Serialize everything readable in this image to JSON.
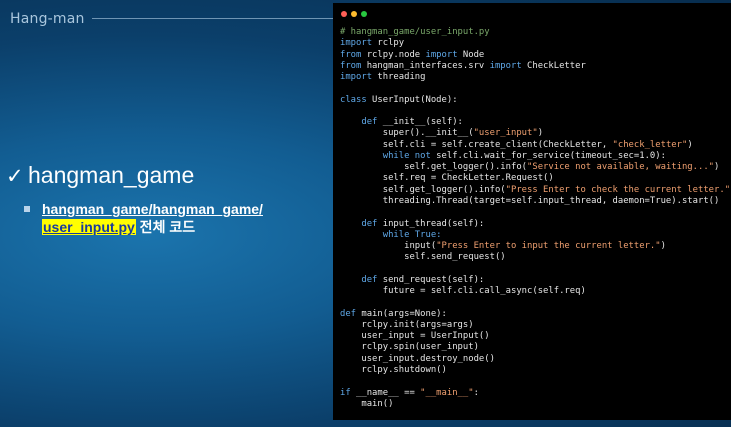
{
  "slide": {
    "title": "Hang-man",
    "heading": "hangman_game",
    "bullet_path": "hangman_game/hangman_game/",
    "bullet_file": "user_input.py",
    "bullet_suffix": " 전체 코드",
    "check_icon": "check-icon",
    "bullet_icon": "square-bullet-icon"
  },
  "editor": {
    "window_dots": [
      "#ff5f57",
      "#febc2e",
      "#28c840"
    ],
    "lines": [
      [
        [
          "c",
          "# hangman_game/user_input.py"
        ]
      ],
      [
        [
          "k",
          "import"
        ],
        [
          "n",
          " rclpy"
        ]
      ],
      [
        [
          "k",
          "from"
        ],
        [
          "n",
          " rclpy.node "
        ],
        [
          "k",
          "import"
        ],
        [
          "n",
          " Node"
        ]
      ],
      [
        [
          "k",
          "from"
        ],
        [
          "n",
          " hangman_interfaces.srv "
        ],
        [
          "k",
          "import"
        ],
        [
          "n",
          " CheckLetter"
        ]
      ],
      [
        [
          "k",
          "import"
        ],
        [
          "n",
          " threading"
        ]
      ],
      [],
      [
        [
          "k",
          "class"
        ],
        [
          "n",
          " UserInput(Node):"
        ]
      ],
      [],
      [
        [
          "n",
          "    "
        ],
        [
          "k",
          "def"
        ],
        [
          "n",
          " __init__(self):"
        ]
      ],
      [
        [
          "n",
          "        super().__init__("
        ],
        [
          "s",
          "\"user_input\""
        ],
        [
          "n",
          ")"
        ]
      ],
      [
        [
          "n",
          "        self.cli = self.create_client(CheckLetter, "
        ],
        [
          "s",
          "\"check_letter\""
        ],
        [
          "n",
          ")"
        ]
      ],
      [
        [
          "n",
          "        "
        ],
        [
          "k",
          "while not"
        ],
        [
          "n",
          " self.cli.wait_for_service(timeout_sec=1.0):"
        ]
      ],
      [
        [
          "n",
          "            self.get_logger().info("
        ],
        [
          "s",
          "\"Service not available, waiting...\""
        ],
        [
          "n",
          ")"
        ]
      ],
      [
        [
          "n",
          "        self.req = CheckLetter.Request()"
        ]
      ],
      [
        [
          "n",
          "        self.get_logger().info("
        ],
        [
          "s",
          "\"Press Enter to check the current letter.\""
        ],
        [
          "n",
          ")"
        ]
      ],
      [
        [
          "n",
          "        threading.Thread(target=self.input_thread, daemon=True).start()"
        ]
      ],
      [],
      [
        [
          "n",
          "    "
        ],
        [
          "k",
          "def"
        ],
        [
          "n",
          " input_thread(self):"
        ]
      ],
      [
        [
          "n",
          "        "
        ],
        [
          "k",
          "while True:"
        ]
      ],
      [
        [
          "n",
          "            input("
        ],
        [
          "s",
          "\"Press Enter to input the current letter.\""
        ],
        [
          "n",
          ")"
        ]
      ],
      [
        [
          "n",
          "            self.send_request()"
        ]
      ],
      [],
      [
        [
          "n",
          "    "
        ],
        [
          "k",
          "def"
        ],
        [
          "n",
          " send_request(self):"
        ]
      ],
      [
        [
          "n",
          "        future = self.cli.call_async(self.req)"
        ]
      ],
      [],
      [
        [
          "k",
          "def"
        ],
        [
          "n",
          " main(args=None):"
        ]
      ],
      [
        [
          "n",
          "    rclpy.init(args=args)"
        ]
      ],
      [
        [
          "n",
          "    user_input = UserInput()"
        ]
      ],
      [
        [
          "n",
          "    rclpy.spin(user_input)"
        ]
      ],
      [
        [
          "n",
          "    user_input.destroy_node()"
        ]
      ],
      [
        [
          "n",
          "    rclpy.shutdown()"
        ]
      ],
      [],
      [
        [
          "k",
          "if"
        ],
        [
          "n",
          " __name__ == "
        ],
        [
          "s",
          "\"__main__\""
        ],
        [
          "n",
          ":"
        ]
      ],
      [
        [
          "n",
          "    main()"
        ]
      ]
    ]
  }
}
